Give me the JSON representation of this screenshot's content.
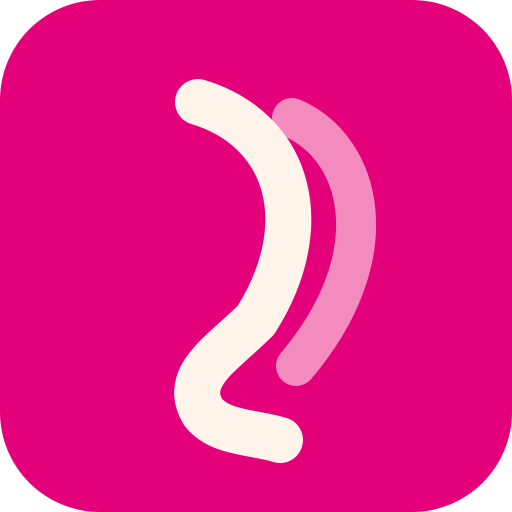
{
  "icon": {
    "name": "app-icon",
    "shape": "rounded-square",
    "glyph": "double-curved-stroke-logo-icon"
  },
  "colors": {
    "background": "#E4007A",
    "front_stroke": "#FFF4E9",
    "back_stroke": "#F48BBF"
  }
}
